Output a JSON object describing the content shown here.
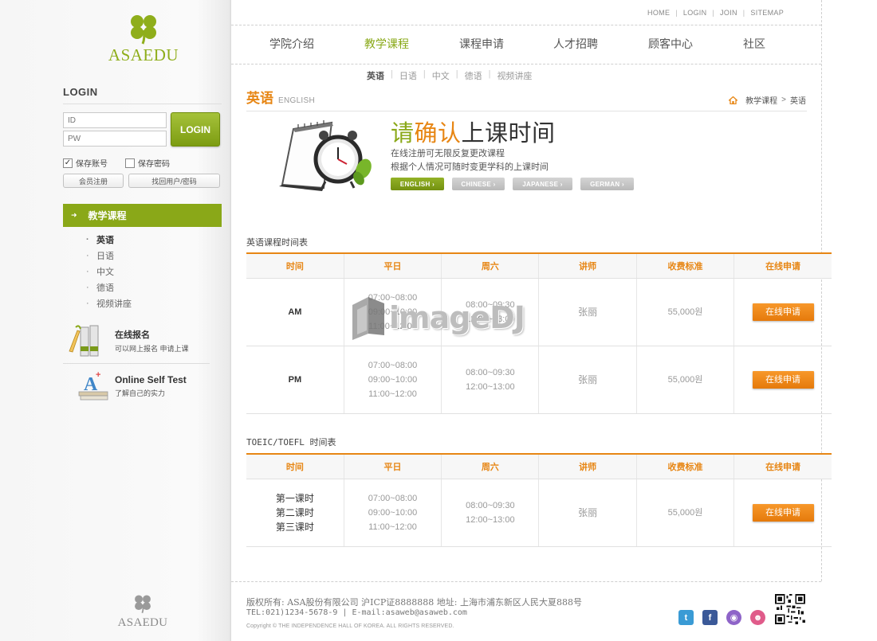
{
  "brand": {
    "name": "ASAEDU"
  },
  "login": {
    "title": "LOGIN",
    "id_placeholder": "ID",
    "pw_placeholder": "PW",
    "button": "LOGIN",
    "save_id": "保存账号",
    "save_pw": "保存密码",
    "save_id_checked": true,
    "save_pw_checked": false,
    "register": "会员注册",
    "find": "找回用户/密码"
  },
  "sidebar": {
    "menu_head": "教学课程",
    "items": [
      {
        "label": "英语",
        "active": true
      },
      {
        "label": "日语",
        "active": false
      },
      {
        "label": "中文",
        "active": false
      },
      {
        "label": "德语",
        "active": false
      },
      {
        "label": "视频讲座",
        "active": false
      }
    ],
    "promo1": {
      "title": "在线报名",
      "sub": "可以网上报名  申请上课"
    },
    "promo2": {
      "title": "Online Self Test",
      "sub": "了解自己的实力"
    }
  },
  "util": {
    "home": "HOME",
    "login": "LOGIN",
    "join": "JOIN",
    "sitemap": "SITEMAP"
  },
  "gnav": [
    {
      "label": "学院介绍",
      "active": false
    },
    {
      "label": "教学课程",
      "active": true
    },
    {
      "label": "课程申请",
      "active": false
    },
    {
      "label": "人才招聘",
      "active": false
    },
    {
      "label": "顾客中心",
      "active": false
    },
    {
      "label": "社区",
      "active": false
    }
  ],
  "snav": [
    {
      "label": "英语",
      "active": true
    },
    {
      "label": "日语",
      "active": false
    },
    {
      "label": "中文",
      "active": false
    },
    {
      "label": "德语",
      "active": false
    },
    {
      "label": "视频讲座",
      "active": false
    }
  ],
  "page": {
    "title": "英语",
    "title_en": "ENGLISH",
    "crumb1": "教学课程",
    "crumb_sep": ">",
    "crumb2": "英语"
  },
  "banner": {
    "heading_green": "请",
    "heading_orange": "确认",
    "heading_rest": "上课时间",
    "line1": "在线注册可无限反复更改课程",
    "line2": "根据个人情况可随时变更学科的上课时间",
    "langs": [
      {
        "label": "ENGLISH",
        "active": true
      },
      {
        "label": "CHINESE",
        "active": false
      },
      {
        "label": "JAPANESE",
        "active": false
      },
      {
        "label": "GERMAN",
        "active": false
      }
    ]
  },
  "table1": {
    "title": "英语课程时间表",
    "headers": [
      "时间",
      "平日",
      "周六",
      "讲师",
      "收费标准",
      "在线申请"
    ],
    "rows": [
      {
        "label": "AM",
        "weekday": [
          "07:00~08:00",
          "09:00~10:00",
          "11:00~12:00"
        ],
        "saturday": [
          "08:00~09:30",
          "12:00~13:00"
        ],
        "teacher": "张丽",
        "fee": "55,000원",
        "apply": "在线申请"
      },
      {
        "label": "PM",
        "weekday": [
          "07:00~08:00",
          "09:00~10:00",
          "11:00~12:00"
        ],
        "saturday": [
          "08:00~09:30",
          "12:00~13:00"
        ],
        "teacher": "张丽",
        "fee": "55,000원",
        "apply": "在线申请"
      }
    ]
  },
  "table2": {
    "title": "TOEIC/TOEFL 时间表",
    "headers": [
      "时间",
      "平日",
      "周六",
      "讲师",
      "收费标准",
      "在线申请"
    ],
    "rows": [
      {
        "label": [
          "第一课时",
          "第二课时",
          "第三课时"
        ],
        "weekday": [
          "07:00~08:00",
          "09:00~10:00",
          "11:00~12:00"
        ],
        "saturday": [
          "08:00~09:30",
          "12:00~13:00"
        ],
        "teacher": "张丽",
        "fee": "55,000원",
        "apply": "在线申请"
      }
    ]
  },
  "watermark": "imageDJ",
  "footer": {
    "line1": "版权所有: ASA股份有限公司 沪ICP证8888888 地址: 上海市浦东新区人民大夏888号",
    "line2": "TEL:021)1234-5678-9 | E-mail:asaweb@asaweb.com",
    "line3": "Copyright © THE INDEPENDENCE HALL OF KOREA. ALL RIGHTS RESERVED.",
    "social": [
      {
        "name": "twitter-icon",
        "color": "#3a9bd5",
        "glyph": "t"
      },
      {
        "name": "facebook-icon",
        "color": "#3b5998",
        "glyph": "f"
      },
      {
        "name": "me2day-icon",
        "color": "#8e64c8",
        "glyph": "◉"
      },
      {
        "name": "blog-icon",
        "color": "#e05b8a",
        "glyph": "☻"
      }
    ]
  },
  "colors": {
    "accent_green": "#8aa818",
    "accent_orange": "#e78614"
  }
}
